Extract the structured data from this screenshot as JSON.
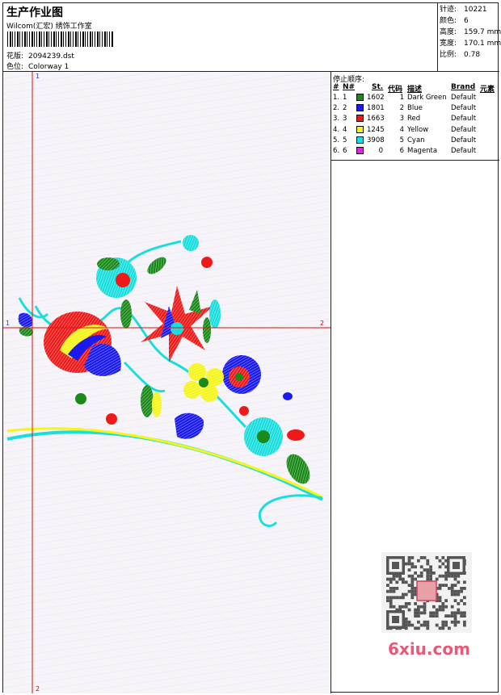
{
  "header": {
    "title": "生产作业图",
    "company": "Wilcom(汇宏) 绣饰工作室",
    "design_label": "花版:",
    "design_file": "2094239.dst",
    "colorway_label": "色位:",
    "colorway": "Colorway 1"
  },
  "stats": {
    "stitches_label": "针迹:",
    "stitches": "10221",
    "colors_label": "颜色:",
    "colors": "6",
    "height_label": "高度:",
    "height": "159.7 mm",
    "width_label": "宽度:",
    "width": "170.1 mm",
    "scale_label": "比例:",
    "scale": "0.78"
  },
  "stop_sequence": {
    "title": "停止顺序:",
    "columns": [
      "#",
      "N#",
      "St.",
      "代码",
      "描述",
      "Brand",
      "元素"
    ],
    "rows": [
      {
        "idx": "1.",
        "n": "1",
        "color": "#1a8a1a",
        "st": "1602",
        "code": "1",
        "desc": "Dark Green",
        "brand": "Default"
      },
      {
        "idx": "2.",
        "n": "2",
        "color": "#1a1aee",
        "st": "1801",
        "code": "2",
        "desc": "Blue",
        "brand": "Default"
      },
      {
        "idx": "3.",
        "n": "3",
        "color": "#ee1a1a",
        "st": "1663",
        "code": "3",
        "desc": "Red",
        "brand": "Default"
      },
      {
        "idx": "4.",
        "n": "4",
        "color": "#f5f51a",
        "st": "1245",
        "code": "4",
        "desc": "Yellow",
        "brand": "Default"
      },
      {
        "idx": "5.",
        "n": "5",
        "color": "#1adede",
        "st": "3908",
        "code": "5",
        "desc": "Cyan",
        "brand": "Default"
      },
      {
        "idx": "6.",
        "n": "6",
        "color": "#ee1aee",
        "st": "0",
        "code": "6",
        "desc": "Magenta",
        "brand": "Default"
      }
    ]
  },
  "axes": {
    "v_top": "1",
    "v_bottom": "2",
    "h_left": "1",
    "h_right": "2"
  },
  "watermark": {
    "site": "6xiu.com"
  }
}
